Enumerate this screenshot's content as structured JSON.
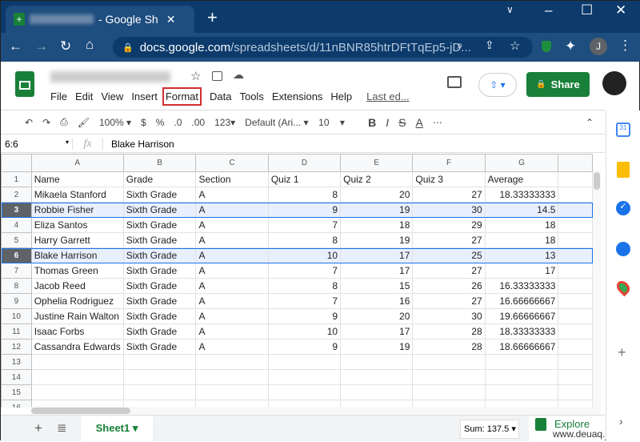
{
  "browser": {
    "tab_title": "- Google Sh",
    "url_host": "docs.google.com",
    "url_path": "/spreadsheets/d/11nBNR85htrDFtTqEp5-jD...",
    "profile": "J"
  },
  "app": {
    "menu": [
      "File",
      "Edit",
      "View",
      "Insert",
      "Format",
      "Data",
      "Tools",
      "Extensions",
      "Help"
    ],
    "last_edit": "Last ed...",
    "share": "Share",
    "highlighted_menu": "Format",
    "accent": "#188038"
  },
  "toolbar": {
    "zoom": "100%",
    "currency": "$",
    "percent": "%",
    "dec_less": ".0",
    "dec_more": ".00",
    "format": "123",
    "font": "Default (Ari...",
    "size": "10",
    "bold": "B",
    "italic": "I",
    "strike": "S",
    "color": "A",
    "more": "⋯"
  },
  "formula": {
    "ref": "6:6",
    "fx": "fx",
    "value": "Blake Harrison"
  },
  "columns": [
    "A",
    "B",
    "C",
    "D",
    "E",
    "F",
    "G"
  ],
  "rows": [
    [
      "Name",
      "Grade",
      "Section",
      "Quiz 1",
      "Quiz 2",
      "Quiz 3",
      "Average"
    ],
    [
      "Mikaela Stanford",
      "Sixth Grade",
      "A",
      "8",
      "20",
      "27",
      "18.33333333"
    ],
    [
      "Robbie Fisher",
      "Sixth Grade",
      "A",
      "9",
      "19",
      "30",
      "14.5"
    ],
    [
      "Eliza Santos",
      "Sixth Grade",
      "A",
      "7",
      "18",
      "29",
      "18"
    ],
    [
      "Harry Garrett",
      "Sixth Grade",
      "A",
      "8",
      "19",
      "27",
      "18"
    ],
    [
      "Blake Harrison",
      "Sixth Grade",
      "A",
      "10",
      "17",
      "25",
      "13"
    ],
    [
      "Thomas Green",
      "Sixth Grade",
      "A",
      "7",
      "17",
      "27",
      "17"
    ],
    [
      "Jacob Reed",
      "Sixth Grade",
      "A",
      "8",
      "15",
      "26",
      "16.33333333"
    ],
    [
      "Ophelia Rodriguez",
      "Sixth Grade",
      "A",
      "7",
      "16",
      "27",
      "16.66666667"
    ],
    [
      "Justine Rain Walton",
      "Sixth Grade",
      "A",
      "9",
      "20",
      "30",
      "19.66666667"
    ],
    [
      "Isaac Forbs",
      "Sixth Grade",
      "A",
      "10",
      "17",
      "28",
      "18.33333333"
    ],
    [
      "Cassandra Edwards",
      "Sixth Grade",
      "A",
      "9",
      "19",
      "28",
      "18.66666667"
    ],
    [
      "",
      "",
      "",
      "",
      "",
      "",
      ""
    ],
    [
      "",
      "",
      "",
      "",
      "",
      "",
      ""
    ],
    [
      "",
      "",
      "",
      "",
      "",
      "",
      ""
    ],
    [
      "",
      "",
      "",
      "",
      "",
      "",
      ""
    ]
  ],
  "selected_rows": [
    3,
    6
  ],
  "bottom": {
    "sheet": "Sheet1",
    "sum": "Sum: 137.5",
    "explore": "Explore"
  },
  "watermark": "www.deuaq.com"
}
